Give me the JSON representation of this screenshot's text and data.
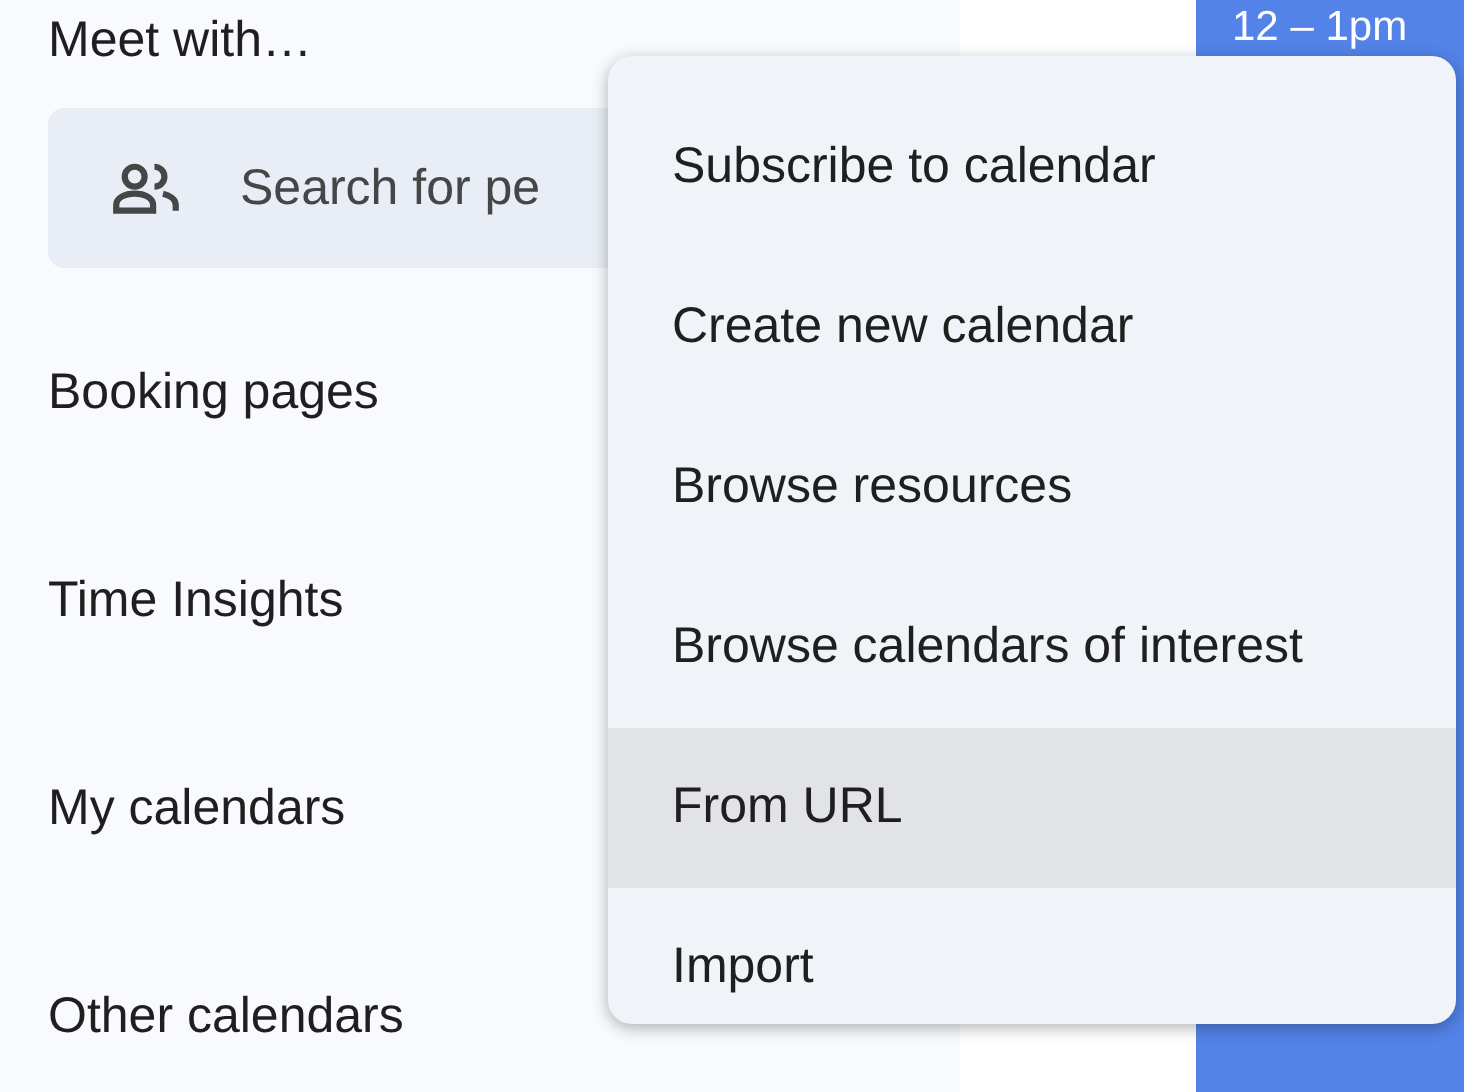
{
  "sidebar": {
    "meet_with": {
      "title": "Meet with…",
      "search": {
        "placeholder": "Search for pe"
      }
    },
    "sections": [
      {
        "label": "Booking pages"
      },
      {
        "label": "Time Insights"
      },
      {
        "label": "My calendars"
      },
      {
        "label": "Other calendars"
      }
    ]
  },
  "calendar": {
    "event": {
      "time": "12 – 1pm"
    }
  },
  "menu": {
    "items": [
      {
        "label": "Subscribe to calendar",
        "selected": false
      },
      {
        "label": "Create new calendar",
        "selected": false
      },
      {
        "label": "Browse resources",
        "selected": false
      },
      {
        "label": "Browse calendars of interest",
        "selected": false
      },
      {
        "label": "From URL",
        "selected": true
      },
      {
        "label": "Import",
        "selected": false
      }
    ]
  }
}
